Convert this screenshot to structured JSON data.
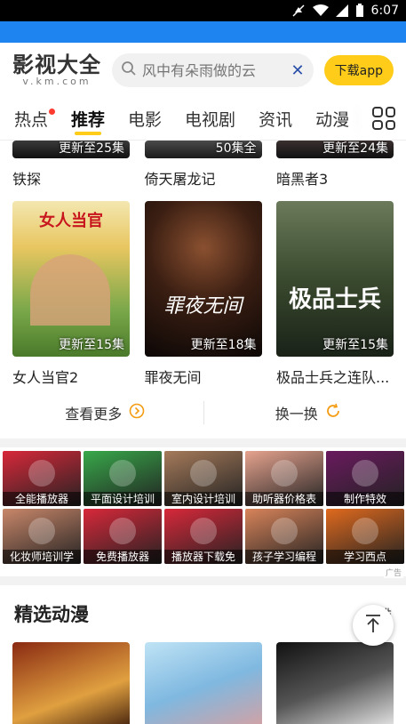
{
  "status": {
    "time": "6:07"
  },
  "header": {
    "logo_main": "影视大全",
    "logo_sub": "v.km.com",
    "search_placeholder": "风中有朵雨做的云",
    "download_label": "下载app"
  },
  "tabs": [
    {
      "label": "热点",
      "dot": true
    },
    {
      "label": "推荐",
      "active": true
    },
    {
      "label": "电影"
    },
    {
      "label": "电视剧"
    },
    {
      "label": "资讯"
    },
    {
      "label": "动漫"
    }
  ],
  "top_row": [
    {
      "badge": "更新至25集",
      "title": "铁探"
    },
    {
      "badge": "50集全",
      "title": "倚天屠龙记"
    },
    {
      "badge": "更新至24集",
      "title": "暗黑者3"
    }
  ],
  "main_row": [
    {
      "badge": "更新至15集",
      "title": "女人当官2",
      "poster_text": "女人当官"
    },
    {
      "badge": "更新至18集",
      "title": "罪夜无间",
      "poster_text": "罪夜无间"
    },
    {
      "badge": "更新至15集",
      "title": "极品士兵之连队...",
      "poster_text": "极品士兵"
    }
  ],
  "actions": {
    "more": "查看更多",
    "refresh": "换一换"
  },
  "ads": [
    {
      "label": "全能播放器",
      "color": "#d8283a"
    },
    {
      "label": "平面设计培训",
      "color": "#38a84a"
    },
    {
      "label": "室内设计培训",
      "color": "#a57a5a"
    },
    {
      "label": "助听器价格表",
      "color": "#e6a38e"
    },
    {
      "label": "制作特效",
      "color": "#6a1a5e"
    },
    {
      "label": "化妆师培训学",
      "color": "#c9876a"
    },
    {
      "label": "免费播放器",
      "color": "#d8283a"
    },
    {
      "label": "播放器下载免",
      "color": "#d8283a"
    },
    {
      "label": "孩子学习编程",
      "color": "#d8845a"
    },
    {
      "label": "学习西点",
      "color": "#e06a1e"
    }
  ],
  "ad_mark": "广告",
  "anime_section": {
    "title": "精选动漫",
    "right": "排"
  }
}
